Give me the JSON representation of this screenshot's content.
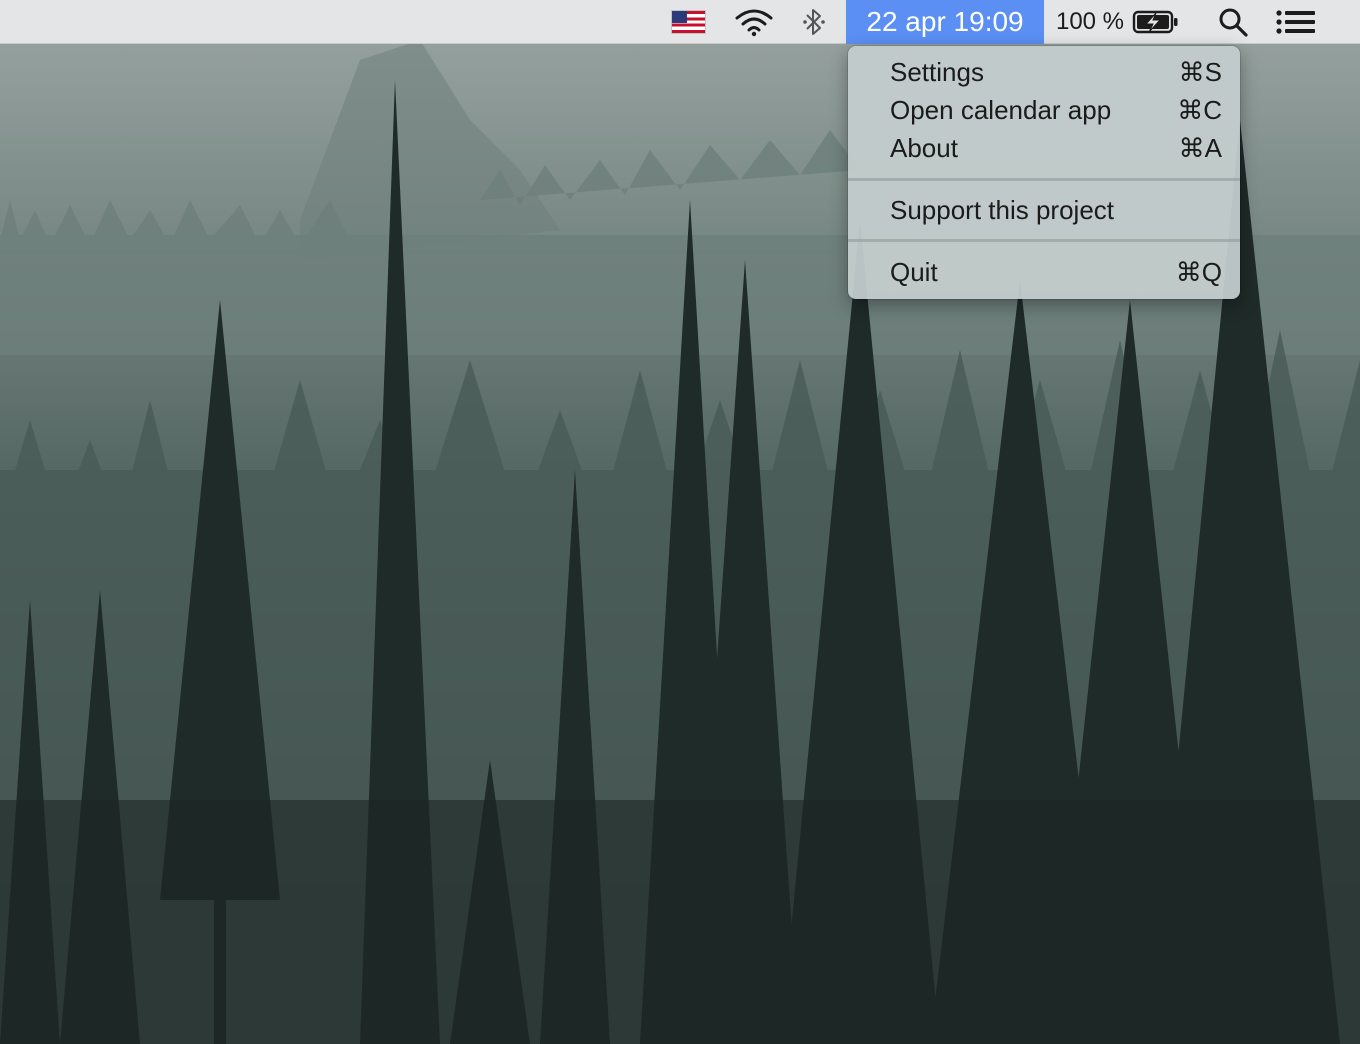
{
  "menubar": {
    "input_source": {
      "icon": "us-flag-icon"
    },
    "wifi": {
      "icon": "wifi-icon"
    },
    "bluetooth": {
      "icon": "bluetooth-icon"
    },
    "clock": {
      "text": "22 apr 19:09",
      "highlight": "#5b8ff3"
    },
    "battery": {
      "percent_text": "100 %",
      "icon": "battery-charging-icon",
      "level": 1.0
    },
    "spotlight": {
      "icon": "search-icon"
    },
    "notification_center": {
      "icon": "list-icon"
    }
  },
  "dropdown": {
    "items": [
      {
        "label": "Settings",
        "shortcut": "⌘S"
      },
      {
        "label": "Open calendar app",
        "shortcut": "⌘C"
      },
      {
        "label": "About",
        "shortcut": "⌘A"
      },
      {
        "label": "Support this project",
        "shortcut": ""
      },
      {
        "label": "Quit",
        "shortcut": "⌘Q"
      }
    ]
  }
}
